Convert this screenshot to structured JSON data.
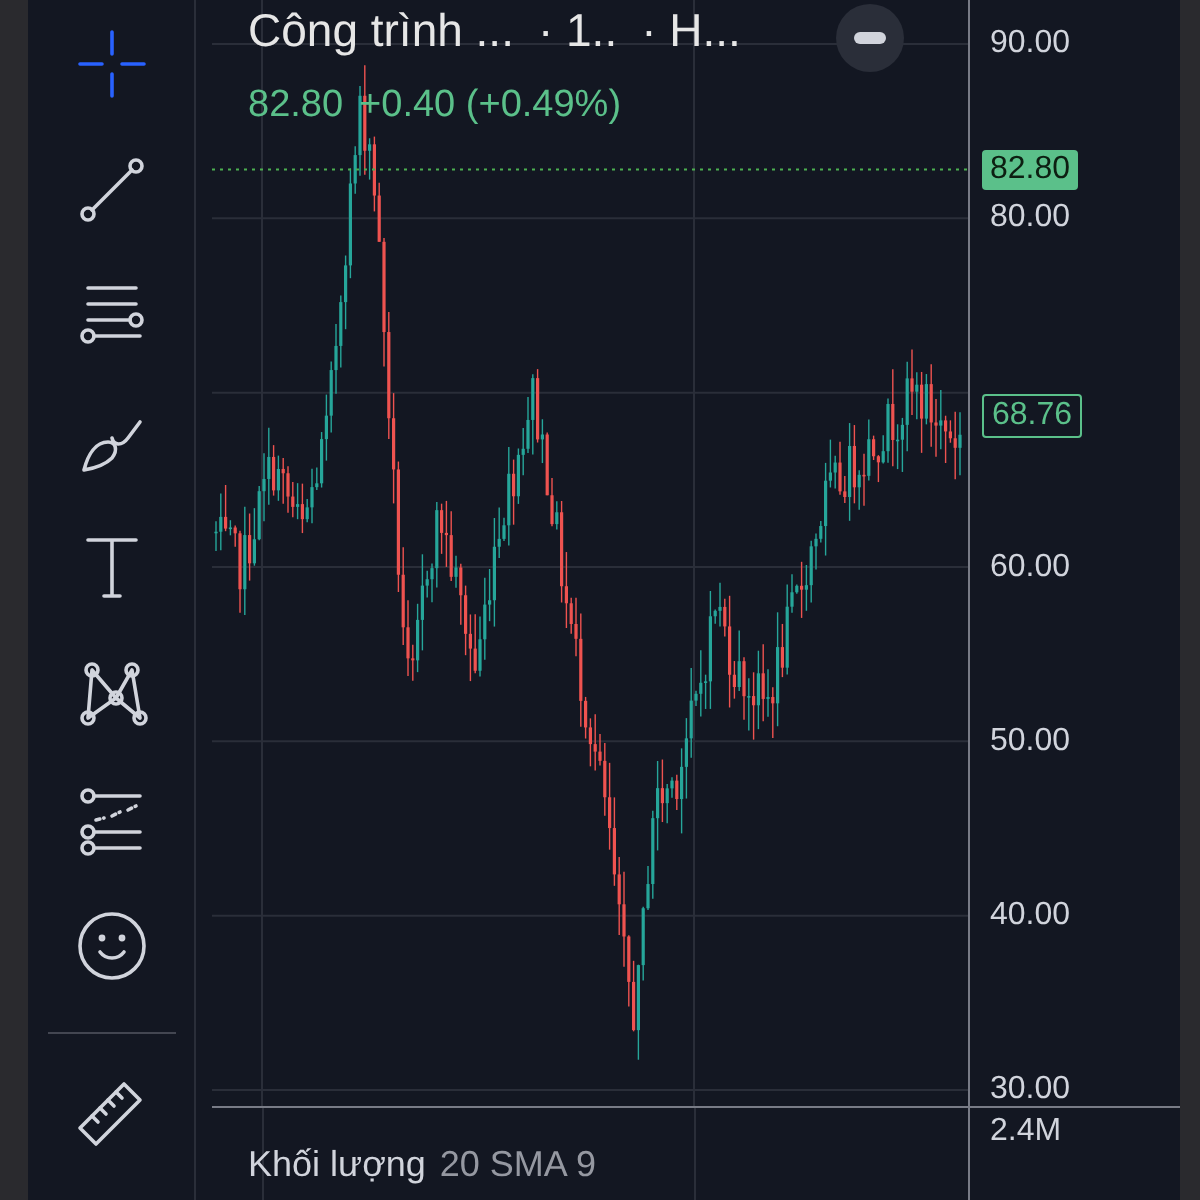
{
  "toolbar": {
    "tools": [
      {
        "kind": "crosshair",
        "selected": true
      },
      {
        "kind": "trend-line",
        "selected": false
      },
      {
        "kind": "fib-lines",
        "selected": false
      },
      {
        "kind": "brush",
        "selected": false
      },
      {
        "kind": "text",
        "selected": false
      },
      {
        "kind": "pattern",
        "selected": false
      },
      {
        "kind": "prediction",
        "selected": false
      },
      {
        "kind": "smiley",
        "selected": false
      },
      {
        "kind": "ruler",
        "selected": false
      }
    ]
  },
  "chart": {
    "title": "Công trình ...",
    "interval": "· 1..",
    "exchange": "· H...",
    "quote": {
      "price": "82.80",
      "change": "+0.40 (+0.49%)"
    },
    "price_axis": [
      "90.00",
      "80.00",
      "60.00",
      "50.00",
      "40.00",
      "30.00"
    ],
    "last_price": "82.80",
    "marker_price": "68.76"
  },
  "volume": {
    "title": "Khối lượng",
    "params": "20 SMA 9",
    "axis": "2.4M"
  }
}
